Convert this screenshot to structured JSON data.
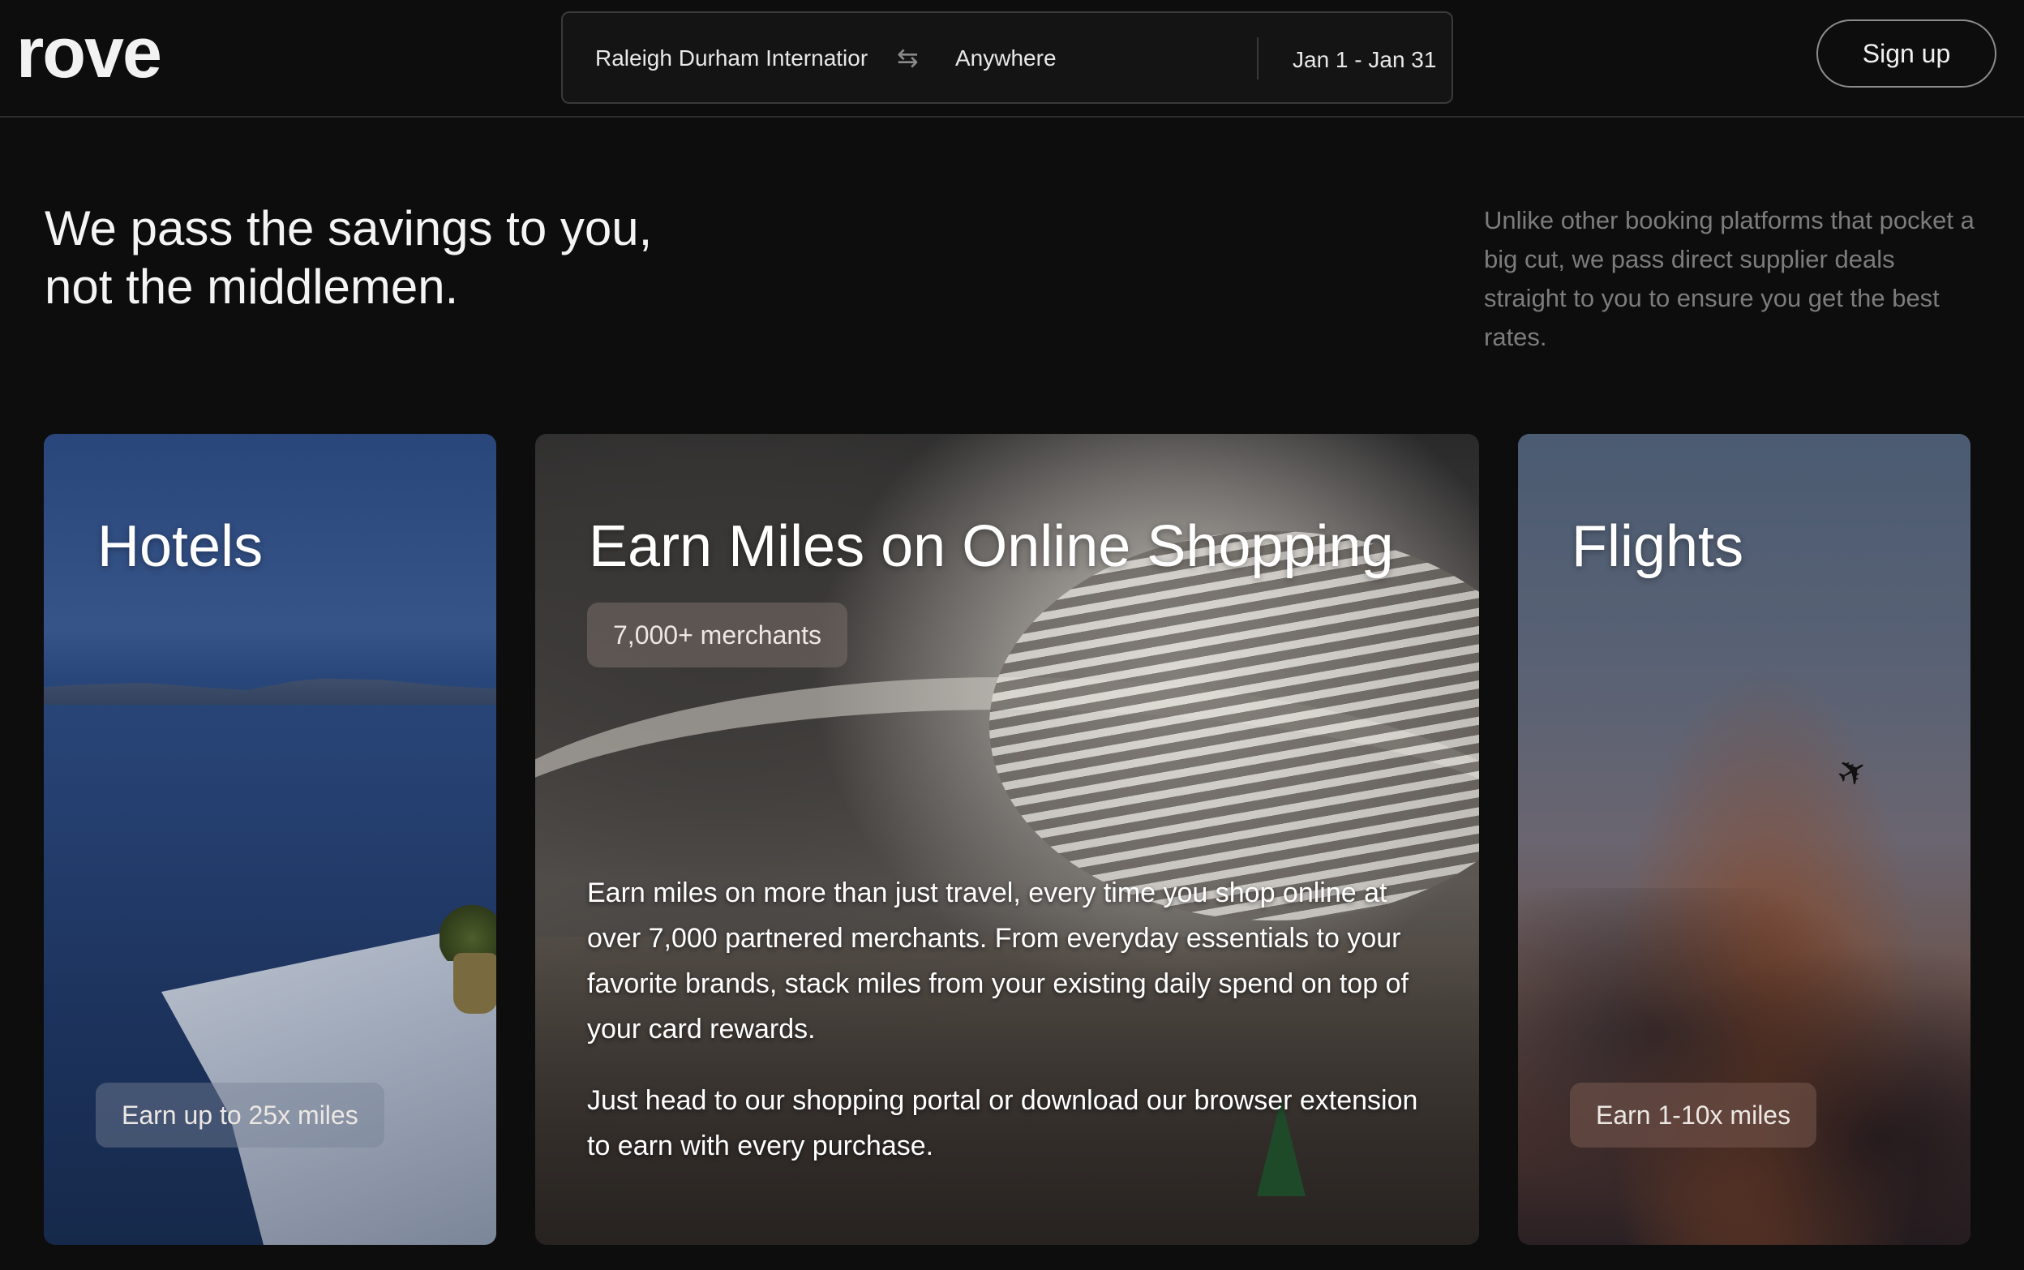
{
  "header": {
    "logo": "rove",
    "search": {
      "from": "Raleigh Durham Internatior",
      "to": "Anywhere",
      "dates": "Jan 1 - Jan 31"
    },
    "signup_label": "Sign up"
  },
  "hero": {
    "headline_line1": "We pass the savings to you,",
    "headline_line2": "not the middlemen.",
    "subtext": "Unlike other booking platforms that pocket a big cut, we pass direct supplier deals straight to you to ensure you get the best rates."
  },
  "cards": {
    "hotels": {
      "title": "Hotels",
      "badge": "Earn up to 25x miles"
    },
    "shopping": {
      "title": "Earn Miles on Online Shopping",
      "badge": "7,000+ merchants",
      "paragraph1": "Earn miles on more than just travel, every time you shop online at over 7,000 partnered merchants. From everyday essentials to your favorite brands, stack miles from your existing daily spend on top of your card rewards.",
      "paragraph2": "Just head to our shopping portal or download our browser extension to earn with every purchase."
    },
    "flights": {
      "title": "Flights",
      "badge": "Earn 1-10x miles"
    }
  },
  "icons": {
    "swap": "swap-arrows-icon",
    "plane": "airplane-icon"
  },
  "colors": {
    "background": "#0d0d0d",
    "text_primary": "#ffffff",
    "text_muted": "#7c7c7c",
    "border": "#3a3a3a"
  }
}
